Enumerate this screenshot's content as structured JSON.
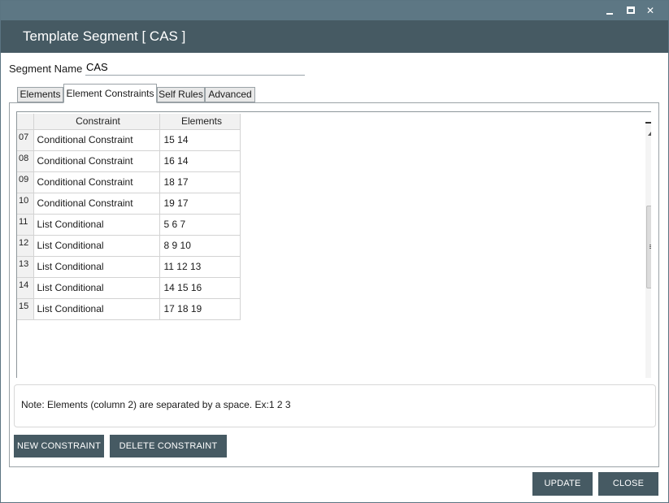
{
  "window": {
    "title": "Template Segment [ CAS ]",
    "controls": {
      "minimize_icon": "minimize-icon",
      "maximize_icon": "maximize-icon",
      "close_icon": "close-icon",
      "close_glyph": "✕"
    }
  },
  "segment": {
    "label": "Segment Name",
    "value": "CAS"
  },
  "tabs": [
    {
      "label": "Elements",
      "active": false
    },
    {
      "label": "Element Constraints",
      "active": true
    },
    {
      "label": "Self Rules",
      "active": false
    },
    {
      "label": "Advanced",
      "active": false
    }
  ],
  "grid": {
    "columns": [
      "Constraint",
      "Elements"
    ],
    "rows": [
      {
        "num": "07",
        "constraint": "Conditional Constraint",
        "elements": "15 14"
      },
      {
        "num": "08",
        "constraint": "Conditional Constraint",
        "elements": "16 14"
      },
      {
        "num": "09",
        "constraint": "Conditional Constraint",
        "elements": "18 17"
      },
      {
        "num": "10",
        "constraint": "Conditional Constraint",
        "elements": "19 17"
      },
      {
        "num": "11",
        "constraint": "List Conditional",
        "elements": "5 6 7"
      },
      {
        "num": "12",
        "constraint": "List Conditional",
        "elements": "8 9 10"
      },
      {
        "num": "13",
        "constraint": "List Conditional",
        "elements": "11 12 13"
      },
      {
        "num": "14",
        "constraint": "List Conditional",
        "elements": "14 15 16"
      },
      {
        "num": "15",
        "constraint": "List Conditional",
        "elements": "17 18 19"
      }
    ]
  },
  "note": "Note: Elements (column 2) are separated by a space. Ex:1 2 3",
  "buttons": {
    "new_constraint": "NEW CONSTRAINT",
    "delete_constraint": "DELETE CONSTRAINT",
    "update": "UPDATE",
    "close": "CLOSE"
  },
  "colors": {
    "titlebar": "#5d7784",
    "header": "#465a63",
    "button": "#465a63"
  }
}
